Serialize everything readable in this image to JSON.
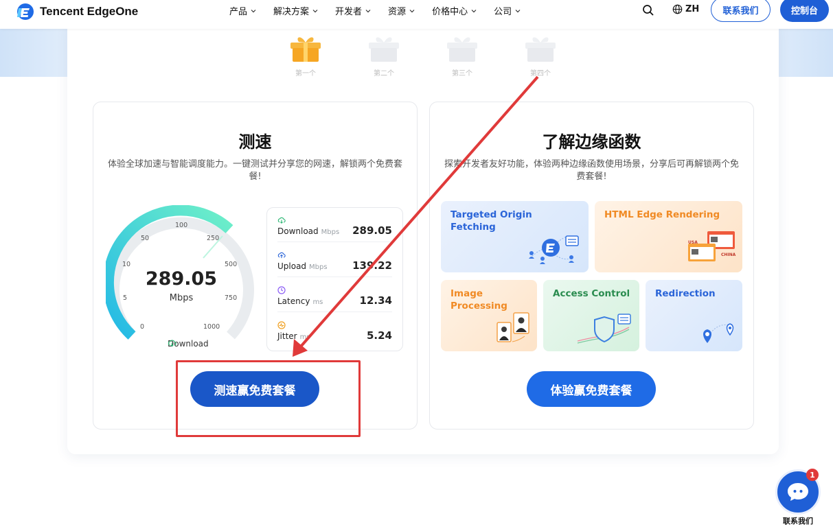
{
  "header": {
    "brand": "Tencent EdgeOne",
    "nav": [
      {
        "label": "产品"
      },
      {
        "label": "解决方案"
      },
      {
        "label": "开发者"
      },
      {
        "label": "资源"
      },
      {
        "label": "价格中心"
      },
      {
        "label": "公司"
      }
    ],
    "language": "ZH",
    "contact_button": "联系我们",
    "console_button": "控制台",
    "accent_color": "#1f5fd6"
  },
  "gifts": [
    {
      "label": "第一个",
      "state": "unlocked"
    },
    {
      "label": "第二个",
      "state": "locked"
    },
    {
      "label": "第三个",
      "state": "locked"
    },
    {
      "label": "第四个",
      "state": "locked"
    }
  ],
  "speed_card": {
    "title": "测速",
    "description": "体验全球加速与智能调度能力。一键测试并分享您的网速，解锁两个免费套餐!",
    "gauge": {
      "value": "289.05",
      "unit": "Mbps",
      "mode_label": "Download",
      "ticks": [
        "0",
        "5",
        "10",
        "50",
        "100",
        "250",
        "500",
        "750",
        "1000"
      ]
    },
    "stats": [
      {
        "name": "Download",
        "unit": "Mbps",
        "value": "289.05",
        "icon": "cloud-download-icon",
        "color": "#2bb673"
      },
      {
        "name": "Upload",
        "unit": "Mbps",
        "value": "139.22",
        "icon": "cloud-upload-icon",
        "color": "#2a64d8"
      },
      {
        "name": "Latency",
        "unit": "ms",
        "value": "12.34",
        "icon": "clock-icon",
        "color": "#8b5cf6"
      },
      {
        "name": "Jitter",
        "unit": "ms",
        "value": "5.24",
        "icon": "pulse-icon",
        "color": "#f0a020"
      }
    ],
    "cta": "测速赢免费套餐"
  },
  "edge_card": {
    "title": "了解边缘函数",
    "description": "探索开发者友好功能，体验两种边缘函数使用场景，分享后可再解锁两个免费套餐!",
    "tiles": [
      {
        "title": "Targeted Origin Fetching"
      },
      {
        "title": "HTML Edge Rendering",
        "tags": [
          "USA",
          "CHINA"
        ]
      },
      {
        "title": "Image Processing"
      },
      {
        "title": "Access Control"
      },
      {
        "title": "Redirection"
      }
    ],
    "cta": "体验赢免费套餐"
  },
  "chat": {
    "label": "联系我们",
    "badge": "1"
  }
}
